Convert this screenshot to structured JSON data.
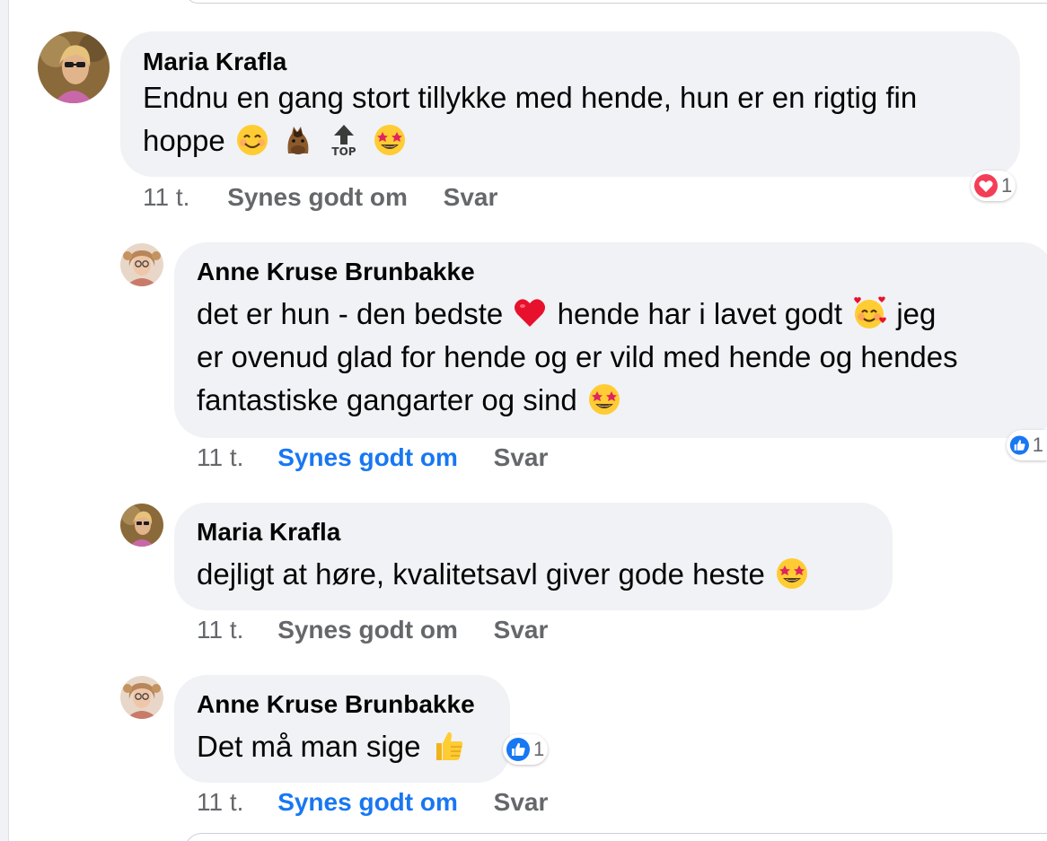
{
  "comments": [
    {
      "author": "Maria Krafla",
      "text_line1": "Endnu en gang stort tillykke med hende, hun er en rigtig fin",
      "text_line2": "hoppe",
      "time": "11 t.",
      "like_label": "Synes godt om",
      "reply_label": "Svar",
      "liked": false,
      "reaction": {
        "icon": "heart-reaction-icon",
        "count": "1"
      },
      "emojis": [
        "smiling-face-icon",
        "horse-face-icon",
        "top-arrow-icon",
        "star-struck-icon"
      ]
    },
    {
      "author": "Anne Kruse Brunbakke",
      "text_line1_a": "det er hun - den bedste",
      "text_line1_b": "hende har i lavet godt",
      "text_line1_c": "jeg",
      "text_line2": "er ovenud glad for hende og er vild med hende og hendes",
      "text_line3": "fantastiske gangarter og sind",
      "time": "11 t.",
      "like_label": "Synes godt om",
      "reply_label": "Svar",
      "liked": true,
      "reaction": {
        "icon": "like-reaction-icon",
        "count": "1"
      }
    },
    {
      "author": "Maria Krafla",
      "text": "dejligt at høre, kvalitetsavl giver gode heste",
      "time": "11 t.",
      "like_label": "Synes godt om",
      "reply_label": "Svar",
      "liked": false
    },
    {
      "author": "Anne Kruse Brunbakke",
      "text": "Det må man sige",
      "time": "11 t.",
      "like_label": "Synes godt om",
      "reply_label": "Svar",
      "liked": true,
      "reaction": {
        "icon": "like-reaction-icon",
        "count": "1"
      }
    }
  ],
  "colors": {
    "bubble": "#f0f2f5",
    "like_active": "#1877f2",
    "muted": "#65676b",
    "text": "#050505"
  }
}
